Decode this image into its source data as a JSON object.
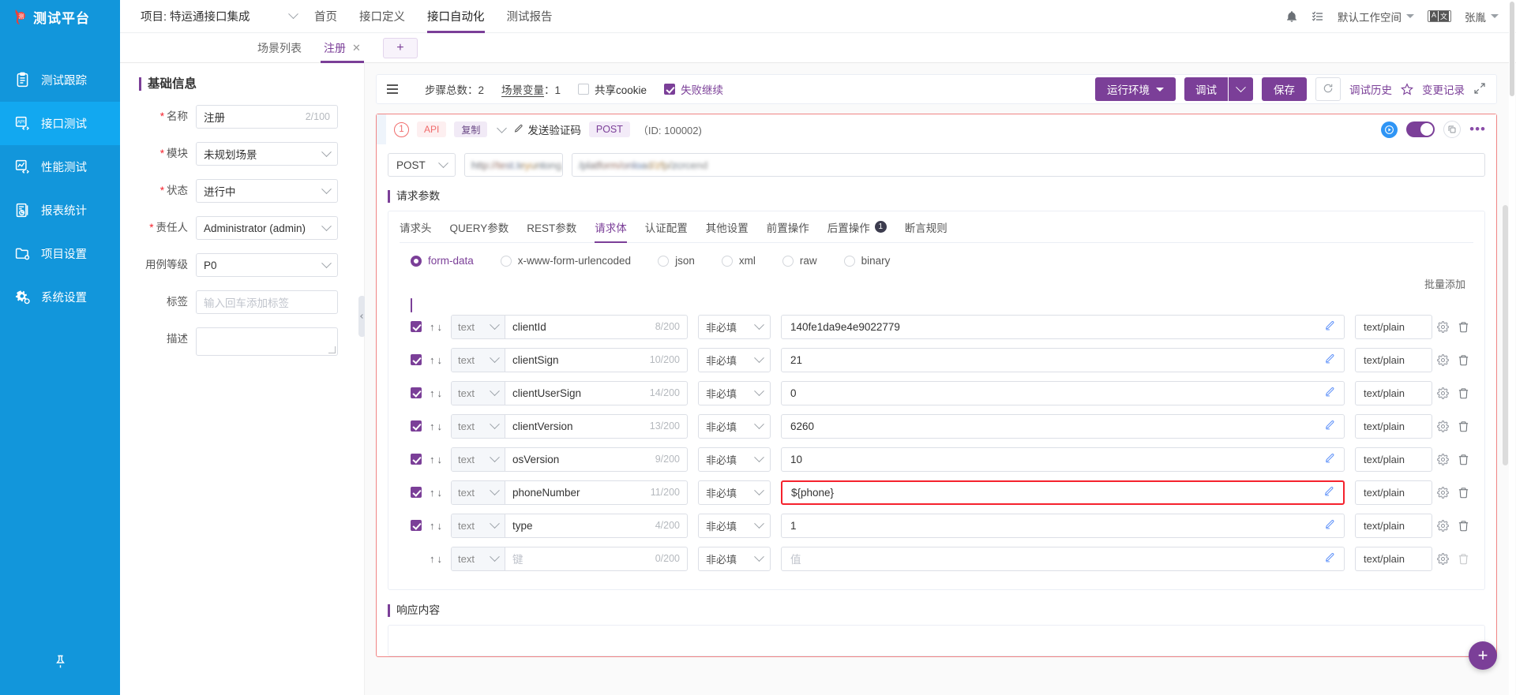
{
  "brand": {
    "name": "测试平台",
    "logo_icon": "flame-logo-icon"
  },
  "sidebar": {
    "items": [
      {
        "label": "测试跟踪",
        "icon": "clipboard-icon",
        "active": false
      },
      {
        "label": "接口测试",
        "icon": "api-code-icon",
        "active": true
      },
      {
        "label": "性能测试",
        "icon": "chart-code-icon",
        "active": false
      },
      {
        "label": "报表统计",
        "icon": "report-pie-icon",
        "active": false
      },
      {
        "label": "项目设置",
        "icon": "folder-gear-icon",
        "active": false
      },
      {
        "label": "系统设置",
        "icon": "gears-icon",
        "active": false
      }
    ],
    "pin_icon": "pin-icon"
  },
  "topbar": {
    "project_label": "项目: 特运通接口集成",
    "nav": [
      {
        "label": "首页",
        "active": false
      },
      {
        "label": "接口定义",
        "active": false
      },
      {
        "label": "接口自动化",
        "active": true
      },
      {
        "label": "测试报告",
        "active": false
      }
    ],
    "bell_icon": "bell-icon",
    "tasks_icon": "task-list-icon",
    "workspace": "默认工作空间",
    "lang_left": "A",
    "lang_right": "文",
    "user": "张胤"
  },
  "tabstrip": {
    "tabs": [
      {
        "label": "场景列表",
        "active": false,
        "closable": false
      },
      {
        "label": "注册",
        "active": true,
        "closable": true
      }
    ],
    "close_glyph": "✕",
    "add_label": "+"
  },
  "form": {
    "section_title": "基础信息",
    "rows": [
      {
        "label": "名称",
        "required": true,
        "type": "input",
        "value": "注册",
        "counter": "2/100",
        "placeholder": ""
      },
      {
        "label": "模块",
        "required": true,
        "type": "select",
        "value": "未规划场景"
      },
      {
        "label": "状态",
        "required": true,
        "type": "select",
        "value": "进行中"
      },
      {
        "label": "责任人",
        "required": true,
        "type": "select",
        "value": "Administrator (admin)"
      },
      {
        "label": "用例等级",
        "required": false,
        "type": "select",
        "value": "P0"
      },
      {
        "label": "标签",
        "required": false,
        "type": "input",
        "value": "",
        "placeholder": "输入回车添加标签",
        "counter": ""
      },
      {
        "label": "描述",
        "required": false,
        "type": "textarea",
        "value": ""
      }
    ],
    "collapse_icon": "chevron-left-icon"
  },
  "toolbar": {
    "menu_icon": "hamburger-icon",
    "step_total_label": "步骤总数：2",
    "scene_var_label": "场景变量",
    "scene_var_value": "：1",
    "share_cookie": {
      "label": "共享cookie",
      "checked": false
    },
    "fail_continue": {
      "label": "失败继续",
      "checked": true
    },
    "env_button": "运行环境",
    "debug_button": "调试",
    "save_button": "保存",
    "refresh_icon": "refresh-icon",
    "debug_history": "调试历史",
    "star_icon": "star-icon",
    "change_log": "变更记录",
    "expand_icon": "expand-arrows-icon"
  },
  "step": {
    "number": "1",
    "tag_api": "API",
    "tag_copy": "复制",
    "expand_icon": "chevron-down-icon",
    "edit_icon": "pencil-icon",
    "name": "发送验证码",
    "method_pill": "POST",
    "id_text": "（ID: 100002)",
    "run_icon": "play-circle-icon",
    "enable_toggle_on": true,
    "copy_icon": "copy-icon",
    "more_icon": "more-dots-icon",
    "method": "POST",
    "host_value": "http://test.teyuntong.",
    "path_value": "/platform/onload/zfp/zcrcend",
    "request_params_title": "请求参数",
    "response_title": "响应内容"
  },
  "param_tabs": [
    {
      "label": "请求头",
      "active": false,
      "badge": ""
    },
    {
      "label": "QUERY参数",
      "active": false,
      "badge": ""
    },
    {
      "label": "REST参数",
      "active": false,
      "badge": ""
    },
    {
      "label": "请求体",
      "active": true,
      "badge": ""
    },
    {
      "label": "认证配置",
      "active": false,
      "badge": ""
    },
    {
      "label": "其他设置",
      "active": false,
      "badge": ""
    },
    {
      "label": "前置操作",
      "active": false,
      "badge": ""
    },
    {
      "label": "后置操作",
      "active": false,
      "badge": "1"
    },
    {
      "label": "断言规则",
      "active": false,
      "badge": ""
    }
  ],
  "body_types": [
    {
      "label": "form-data",
      "selected": true
    },
    {
      "label": "x-www-form-urlencoded",
      "selected": false
    },
    {
      "label": "json",
      "selected": false
    },
    {
      "label": "xml",
      "selected": false
    },
    {
      "label": "raw",
      "selected": false
    },
    {
      "label": "binary",
      "selected": false
    }
  ],
  "batch_add_label": "批量添加",
  "param_table": {
    "header_checked": true,
    "type_default": "text",
    "required_default": "非必填",
    "mime_default": "text/plain",
    "key_placeholder": "键",
    "value_placeholder": "值",
    "edit_icon": "pencil-blue-icon",
    "settings_icon": "gear-icon",
    "delete_icon": "trash-icon",
    "up_glyph": "↑",
    "down_glyph": "↓",
    "rows": [
      {
        "checked": true,
        "type": "text",
        "key": "clientId",
        "counter": "8/200",
        "required": "非必填",
        "value": "140fe1da9e4e9022779",
        "mime": "text/plain",
        "error": false,
        "placeholder_key": "",
        "placeholder_value": ""
      },
      {
        "checked": true,
        "type": "text",
        "key": "clientSign",
        "counter": "10/200",
        "required": "非必填",
        "value": "21",
        "mime": "text/plain",
        "error": false,
        "placeholder_key": "",
        "placeholder_value": ""
      },
      {
        "checked": true,
        "type": "text",
        "key": "clientUserSign",
        "counter": "14/200",
        "required": "非必填",
        "value": "0",
        "mime": "text/plain",
        "error": false,
        "placeholder_key": "",
        "placeholder_value": ""
      },
      {
        "checked": true,
        "type": "text",
        "key": "clientVersion",
        "counter": "13/200",
        "required": "非必填",
        "value": "6260",
        "mime": "text/plain",
        "error": false,
        "placeholder_key": "",
        "placeholder_value": ""
      },
      {
        "checked": true,
        "type": "text",
        "key": "osVersion",
        "counter": "9/200",
        "required": "非必填",
        "value": "10",
        "mime": "text/plain",
        "error": false,
        "placeholder_key": "",
        "placeholder_value": ""
      },
      {
        "checked": true,
        "type": "text",
        "key": "phoneNumber",
        "counter": "11/200",
        "required": "非必填",
        "value": "${phone}",
        "mime": "text/plain",
        "error": true,
        "placeholder_key": "",
        "placeholder_value": ""
      },
      {
        "checked": true,
        "type": "text",
        "key": "type",
        "counter": "4/200",
        "required": "非必填",
        "value": "1",
        "mime": "text/plain",
        "error": false,
        "placeholder_key": "",
        "placeholder_value": ""
      },
      {
        "checked": false,
        "type": "text",
        "key": "",
        "counter": "0/200",
        "required": "非必填",
        "value": "",
        "mime": "text/plain",
        "error": false,
        "placeholder_key": "键",
        "placeholder_value": "值"
      }
    ]
  },
  "fab": {
    "label": "+",
    "icon": "plus-icon"
  },
  "colors": {
    "sidebar_bg": "#1296db",
    "sidebar_active": "#12a8f0",
    "accent_purple": "#7b3f98",
    "error_red": "#f5222d",
    "step_border_red": "#f08585",
    "link_blue": "#2f95f5"
  }
}
